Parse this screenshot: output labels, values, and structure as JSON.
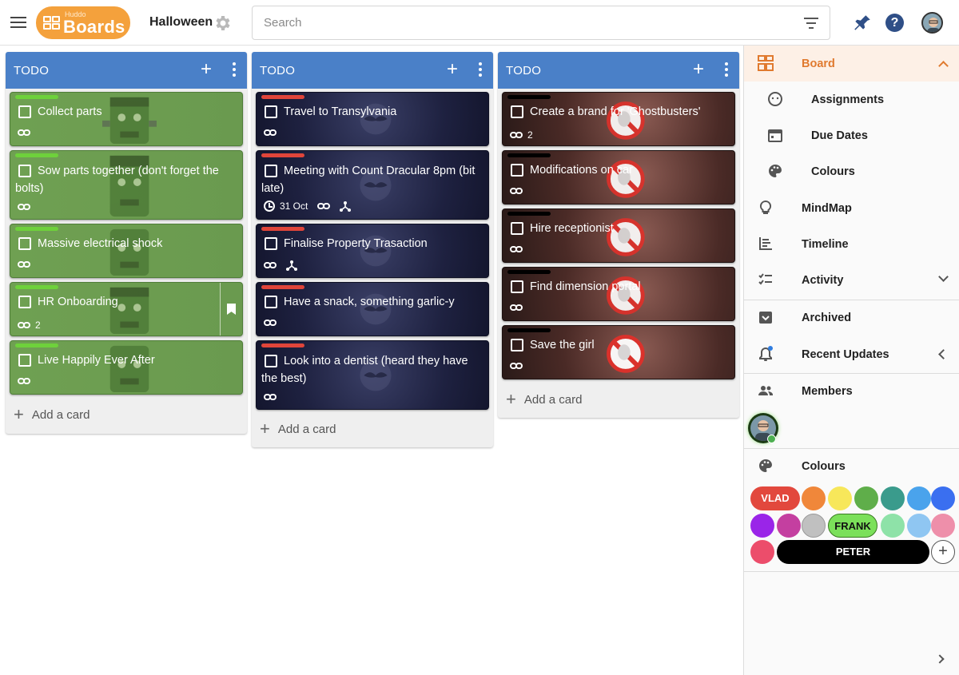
{
  "app": {
    "logo_small": "Huddo",
    "logo_big": "Boards",
    "board_title": "Halloween",
    "search_placeholder": "Search"
  },
  "lists": [
    {
      "title": "TODO",
      "add_card_label": "Add a card",
      "cards": [
        {
          "title": "Collect parts",
          "link_count": ""
        },
        {
          "title": "Sow parts together (don't forget the bolts)",
          "link_count": ""
        },
        {
          "title": "Massive electrical shock",
          "link_count": ""
        },
        {
          "title": "HR Onboarding",
          "link_count": "2"
        },
        {
          "title": "Live Happily Ever After",
          "link_count": ""
        }
      ]
    },
    {
      "title": "TODO",
      "add_card_label": "Add a card",
      "cards": [
        {
          "title": "Travel to Transylvania"
        },
        {
          "title": "Meeting with Count Dracular 8pm (bit late)",
          "due": "31 Oct"
        },
        {
          "title": "Finalise Property Trasaction"
        },
        {
          "title": "Have a snack, something garlic-y"
        },
        {
          "title": "Look into a dentist (heard they have the best)"
        }
      ]
    },
    {
      "title": "TODO",
      "add_card_label": "Add a card",
      "cards": [
        {
          "title": "Create a brand for 'Ghostbusters'",
          "link_count": "2"
        },
        {
          "title": "Modifications on car"
        },
        {
          "title": "Hire receptionist"
        },
        {
          "title": "Find dimension portal"
        },
        {
          "title": "Save the girl"
        }
      ]
    }
  ],
  "panel": {
    "board": "Board",
    "assignments": "Assignments",
    "due_dates": "Due Dates",
    "colours_sub": "Colours",
    "mindmap": "MindMap",
    "timeline": "Timeline",
    "activity": "Activity",
    "archived": "Archived",
    "recent_updates": "Recent Updates",
    "members": "Members",
    "colours": "Colours",
    "labels": {
      "vlad": "VLAD",
      "frank": "FRANK",
      "peter": "PETER"
    }
  },
  "colors": {
    "accent": "#e07a2f",
    "list_header": "#4a80c8",
    "label_green": "#6ed13b",
    "label_red": "#e0453a",
    "label_black": "#000000",
    "swatches_row1": [
      "#f0873a",
      "#f7e75a",
      "#5fae4a",
      "#3a9b8c",
      "#4aa3ec",
      "#3a6ff0"
    ],
    "swatches_row2": [
      "#9a25e8",
      "#c43fa0",
      "#c0c0c0",
      "#8ee2a8",
      "#8fc6f2",
      "#ee8faa"
    ],
    "swatch_row3_first": "#ec4d6b",
    "vlad": "#e2483d",
    "frank": "#7be05a",
    "peter": "#000000"
  },
  "icons": [
    "menu-icon",
    "gear-icon",
    "filter-icon",
    "pin-icon",
    "help-icon",
    "avatar",
    "plus-icon",
    "more-vert-icon",
    "link-icon",
    "clock-icon",
    "tree-icon",
    "bookmark-icon",
    "board-icon",
    "assignments-icon",
    "calendar-icon",
    "palette-icon",
    "lightbulb-icon",
    "timeline-icon",
    "activity-icon",
    "archive-icon",
    "bell-icon",
    "members-icon"
  ]
}
